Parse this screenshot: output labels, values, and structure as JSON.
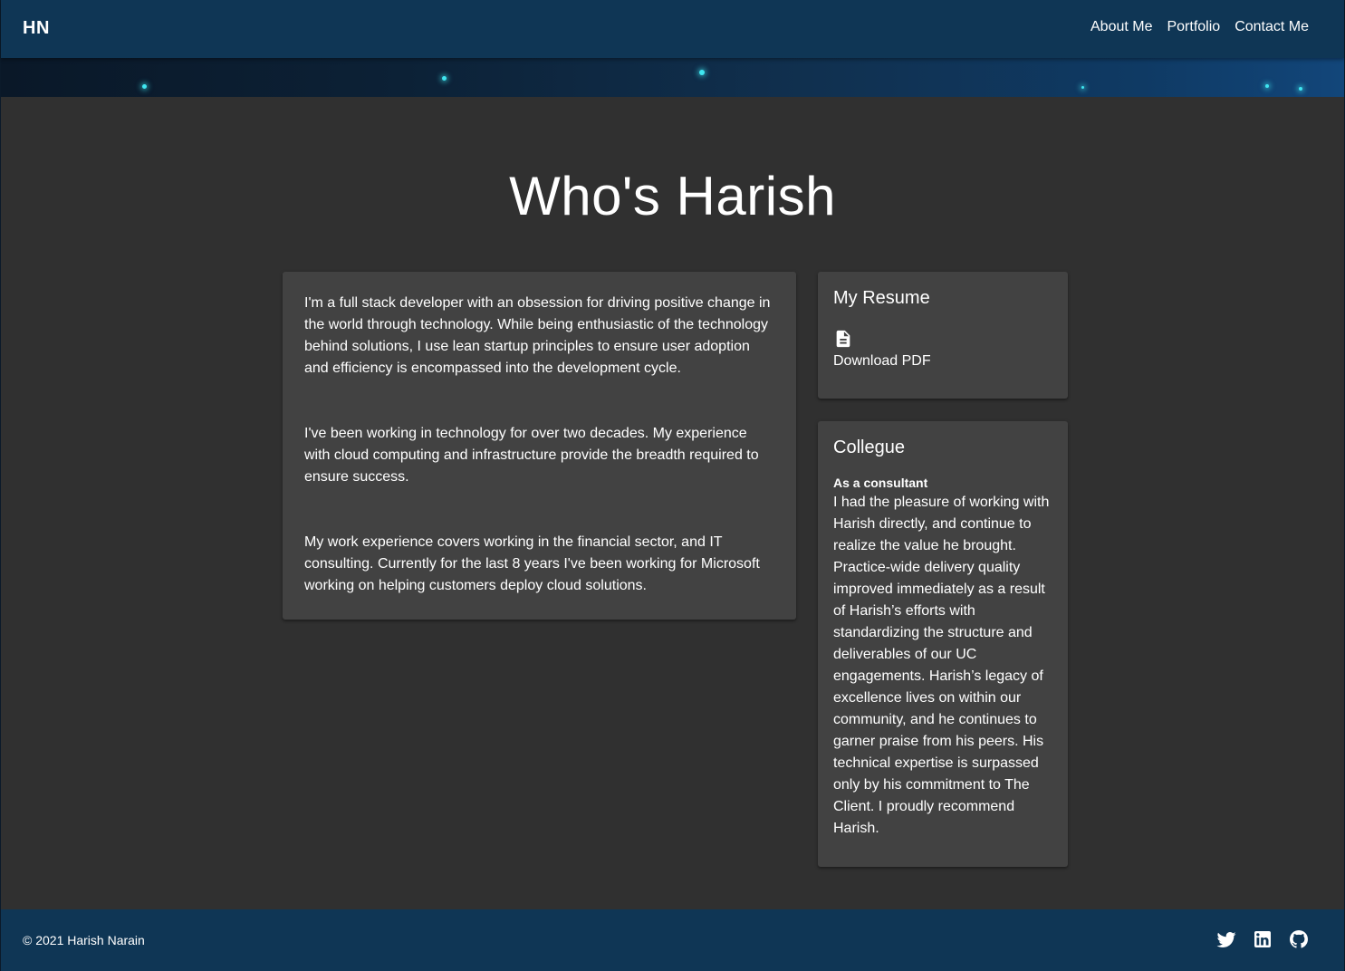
{
  "header": {
    "brand": "HN",
    "nav": [
      "About Me",
      "Portfolio",
      "Contact Me"
    ]
  },
  "main": {
    "title": "Who's Harish",
    "about": {
      "paragraphs": [
        "I'm a full stack developer with an obsession for driving positive change in the world through technology. While being enthusiastic of the technology behind solutions, I use lean startup principles to ensure user adoption and efficiency is encompassed into the development cycle.",
        "I've been working in technology for over two decades. My experience with cloud computing and infrastructure provide the breadth required to ensure success.",
        "My work experience covers working in the financial sector, and IT consulting. Currently for the last 8 years I've been working for Microsoft working on helping customers deploy cloud solutions."
      ]
    },
    "resume": {
      "title": "My Resume",
      "icon": "document-icon",
      "link_label": "Download PDF"
    },
    "colleague": {
      "title": "Collegue",
      "subtitle": "As a consultant",
      "quote": "I had the pleasure of working with Harish directly, and continue to realize the value he brought. Practice-wide delivery quality improved immediately as a result of Harish’s efforts with standardizing the structure and deliverables of our UC engagements. Harish’s legacy of excellence lives on within our community, and he continues to garner praise from his peers. His technical expertise is surpassed only by his commitment to The Client. I proudly recommend Harish."
    }
  },
  "footer": {
    "copyright": "© 2021 Harish Narain",
    "social_icons": [
      "twitter-icon",
      "linkedin-icon",
      "github-icon"
    ]
  },
  "colors": {
    "header_bg": "#0f3655",
    "page_bg": "#303030",
    "card_bg": "#424242",
    "star": "#3fe6f0",
    "text": "#ffffff"
  }
}
